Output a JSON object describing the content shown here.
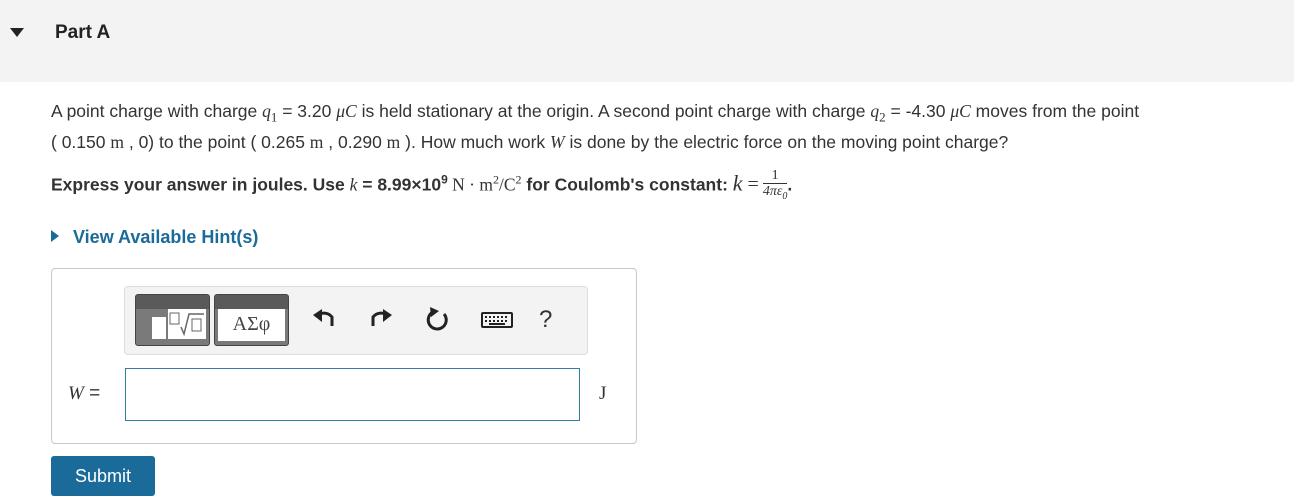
{
  "part": {
    "title": "Part A"
  },
  "problem": {
    "t1": "A point charge with charge ",
    "q1_sym": "q",
    "q1_sub": "1",
    "t2": " = 3.20 ",
    "mu": "μ",
    "C": "C",
    "t3": " is held stationary at the origin. A second point charge with charge ",
    "q2_sym": "q",
    "q2_sub": "2",
    "t4": " = -4.30 ",
    "t5": " moves from the point",
    "l2a": "( 0.150 ",
    "m": "m",
    "l2b": " , 0) to the point ( 0.265 ",
    "l2c": " , 0.290 ",
    "l2d": " ). How much work ",
    "W": "W",
    "l2e": " is done by the electric force on the moving point charge?"
  },
  "instruction": {
    "a": "Express your answer in joules. Use ",
    "k": "k",
    "b": " = 8.99×10",
    "exp": "9",
    "units": " N · m",
    "sq": "2",
    "slash": "/C",
    "c": " for Coulomb's constant: ",
    "eq": " =",
    "num": "1",
    "den": "4πε",
    "den_sub": "0",
    "dot": "."
  },
  "hints": {
    "label": "View Available Hint(s)"
  },
  "toolbar": {
    "greek_label": "ΑΣφ",
    "help_label": "?",
    "icons": [
      "templates-icon",
      "greek-letters-icon",
      "undo-icon",
      "redo-icon",
      "reset-icon",
      "keyboard-icon",
      "help-icon"
    ]
  },
  "answer": {
    "variable": "W",
    "equals": " =",
    "value": "",
    "unit": "J"
  },
  "submit": {
    "label": "Submit"
  },
  "colors": {
    "accent": "#1a6b9a",
    "input_border": "#2f7ea5",
    "header_bg": "#f3f3f3"
  }
}
